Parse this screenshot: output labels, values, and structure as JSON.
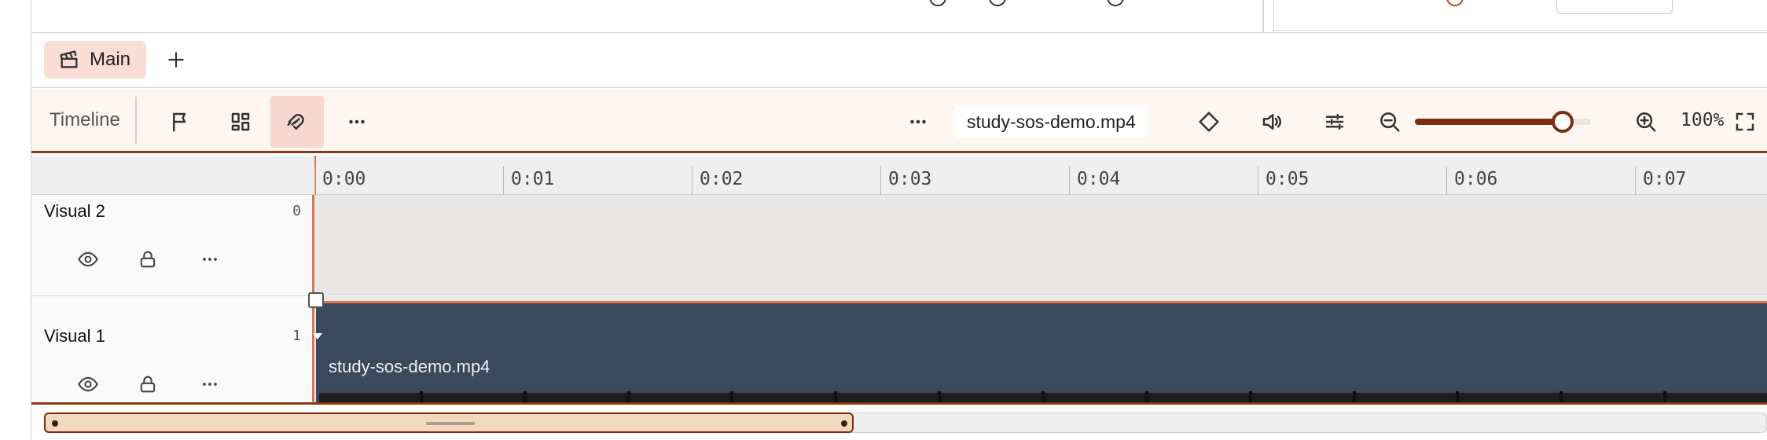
{
  "tabs": {
    "main_label": "Main",
    "add_icon": "plus-icon"
  },
  "toolbar": {
    "label": "Timeline",
    "left_icons": [
      "flag-icon",
      "grid-icon",
      "magnet-icon",
      "more-horizontal-icon"
    ],
    "file_name": "study-sos-demo.mp4",
    "zoom_level": "100%",
    "zoom_fraction": 0.84,
    "accent_color": "#7c2d0e"
  },
  "ruler": {
    "ticks": [
      "0:00",
      "0:01",
      "0:02",
      "0:03",
      "0:04",
      "0:05",
      "0:06",
      "0:07"
    ]
  },
  "tracks": [
    {
      "name": "Visual 2",
      "index": "0"
    },
    {
      "name": "Visual 1",
      "index": "1"
    }
  ],
  "clip": {
    "name": "study-sos-demo.mp4",
    "color": "#3a4a5c"
  },
  "scroll": {
    "visible_fraction": 0.47
  }
}
